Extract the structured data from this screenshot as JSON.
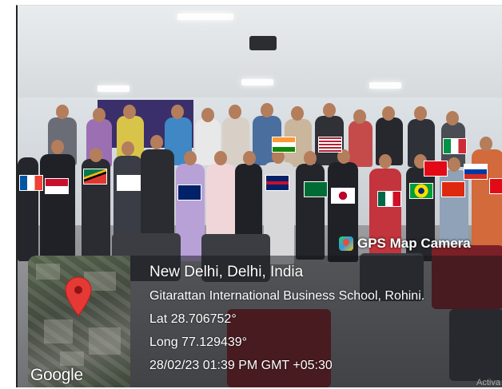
{
  "gps_camera": {
    "app_name": "GPS Map Camera",
    "place": "New Delhi, Delhi, India",
    "address": "Gitarattan International Business School, Rohini.",
    "latitude": "Lat 28.706752°",
    "longitude": "Long 77.129439°",
    "datetime": "28/02/23 01:39 PM GMT +05:30",
    "map_provider": "Google"
  },
  "watermark": "Activa",
  "colors": {
    "overlay": "#14161a",
    "map_pin": "#e53935",
    "text": "#ffffff"
  },
  "icons": [
    "gps-map-camera-logo-icon",
    "map-pin-icon"
  ]
}
